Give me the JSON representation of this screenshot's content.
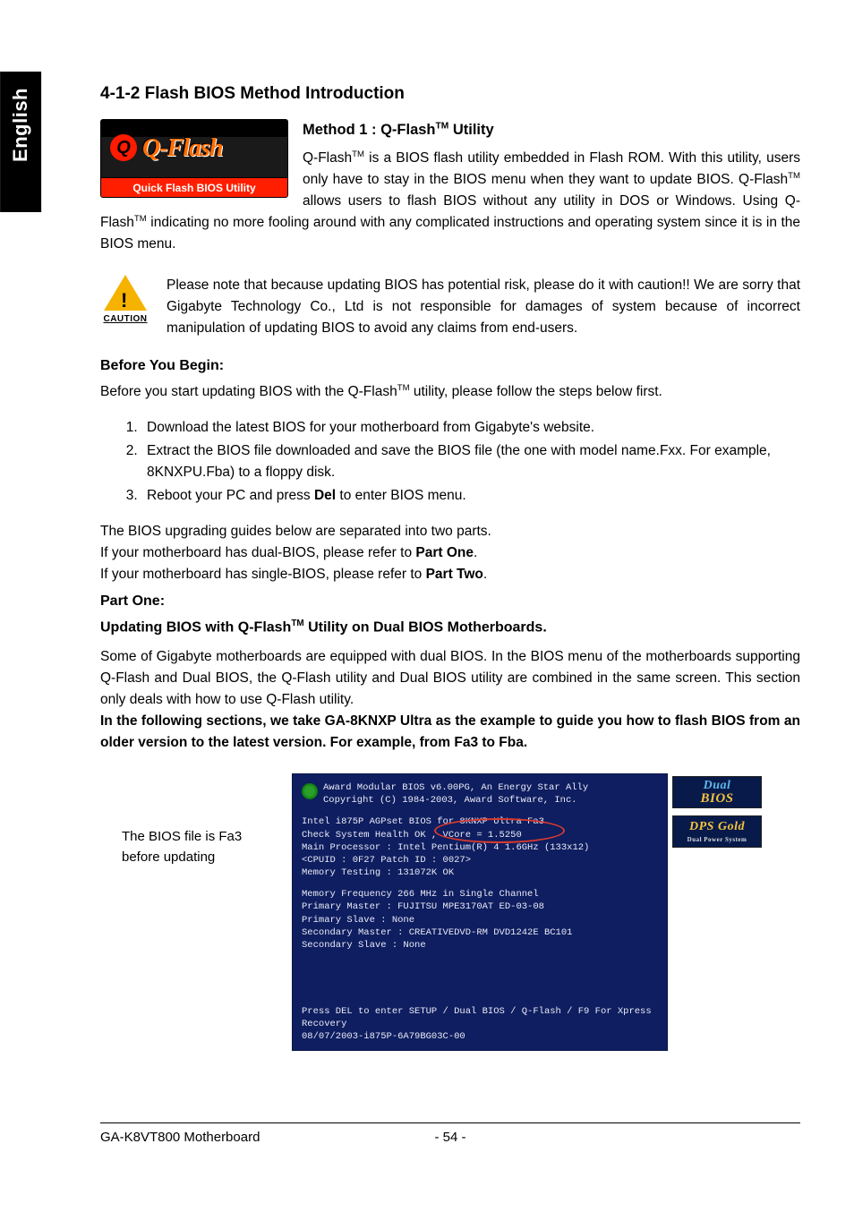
{
  "tab": "English",
  "section_title": "4-1-2   Flash BIOS Method Introduction",
  "method1_title_pre": "Method 1 : Q-Flash",
  "method1_title_post": " Utility",
  "qflash_logo": {
    "main": "Q-Flash",
    "sub": "Quick Flash BIOS Utility",
    "q": "Q"
  },
  "intro_p1a": "Q-Flash",
  "intro_p1b": " is a BIOS flash utility embedded in Flash ROM. With this utility, users only have to stay in the BIOS menu when they want to update BIOS. Q-Flash",
  "intro_p1c": " allows users to flash BIOS without any utility in DOS or Windows. Using Q-Flash",
  "intro_p1d": " indicating no more fooling around with any complicated instructions and operating system since it is in the BIOS menu.",
  "caution_label": "CAUTION",
  "caution_text": "Please note that because updating BIOS has potential risk, please do it with caution!! We are sorry that Gigabyte Technology Co., Ltd is not responsible for damages of system because of incorrect manipulation of updating BIOS to avoid any claims from end-users.",
  "before_heading": "Before You Begin:",
  "before_text_a": "Before you start updating BIOS with the Q-Flash",
  "before_text_b": " utility, please follow the steps below first.",
  "steps": [
    "Download the latest BIOS for your motherboard from Gigabyte's website.",
    "Extract the BIOS file downloaded and save the BIOS file (the one with model name.Fxx. For example, 8KNXPU.Fba) to a floppy disk.",
    "Reboot your PC and press Del to enter BIOS menu."
  ],
  "step3_pre": "Reboot your PC and press ",
  "step3_bold": "Del",
  "step3_post": " to enter BIOS menu.",
  "guides_p1": "The BIOS upgrading guides below are separated into two parts.",
  "guides_p2a": "If your motherboard has dual-BIOS, please refer to ",
  "guides_p2b": "Part One",
  "guides_p2c": ".",
  "guides_p3a": "If your motherboard has single-BIOS, please refer to ",
  "guides_p3b": "Part Two",
  "guides_p3c": ".",
  "part_one_heading": "Part One:",
  "part_one_sub_a": "Updating BIOS with Q-Flash",
  "part_one_sub_b": " Utility on Dual BIOS Motherboards.",
  "part_one_p1": "Some of Gigabyte motherboards are equipped with dual BIOS. In the BIOS menu of the motherboards supporting Q-Flash and Dual BIOS, the Q-Flash utility and Dual BIOS utility are combined in the same screen. This section only deals with how to use Q-Flash utility.",
  "part_one_bold": "In the following sections, we take GA-8KNXP Ultra as the example to guide you how to flash BIOS from an older version to the latest version. For example, from Fa3 to Fba.",
  "bios_note": "The BIOS file is Fa3 before updating",
  "bios": {
    "l1": "Award Modular BIOS v6.00PG, An Energy Star Ally",
    "l2": "Copyright  (C) 1984-2003, Award Software,  Inc.",
    "l3": "Intel i875P AGPset BIOS for 8KNXP Ultra Fa3",
    "l4": "Check System Health OK , VCore = 1.5250",
    "l5": "Main Processor : Intel Pentium(R) 4  1.6GHz (133x12)",
    "l6": "<CPUID : 0F27 Patch ID  : 0027>",
    "l7": "Memory Testing  : 131072K OK",
    "l8": "Memory Frequency 266 MHz in Single Channel",
    "l9": "Primary Master : FUJITSU MPE3170AT ED-03-08",
    "l10": "Primary Slave : None",
    "l11": "Secondary Master : CREATIVEDVD-RM DVD1242E BC101",
    "l12": "Secondary Slave : None",
    "l13": "Press DEL to enter SETUP / Dual BIOS / Q-Flash / F9 For Xpress Recovery",
    "l14": "08/07/2003-i875P-6A79BG03C-00"
  },
  "badges": {
    "dual_top": "Dual",
    "dual_bot": "BIOS",
    "dps_main": "DPS Gold",
    "dps_sub": "Dual Power System"
  },
  "footer": {
    "left": "GA-K8VT800 Motherboard",
    "center": "- 54 -"
  }
}
